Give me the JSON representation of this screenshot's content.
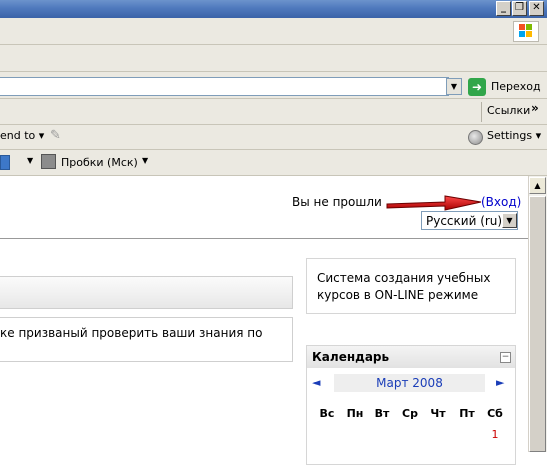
{
  "window": {
    "min_label": "_",
    "max_label": "❐",
    "close_label": "✕"
  },
  "address": {
    "go_label": "Переход"
  },
  "links_bar": {
    "links_label": "Ссылки",
    "chevron": "»"
  },
  "toolbar": {
    "send_to_label": "end to ▾",
    "settings_label": "Settings ▾"
  },
  "traffic_bar": {
    "traffic_label": "Пробки (Мск)"
  },
  "page": {
    "not_logged_in": "Вы не прошли",
    "login_link": "(Вход)",
    "language_value": "Русский (ru)",
    "description_fragment": "ке призваный проверить ваши знания по",
    "system_description": "Система создания учебных курсов в ON-LINE режиме"
  },
  "calendar": {
    "title": "Календарь",
    "month": "Март 2008",
    "prev": "◄",
    "next": "►",
    "weekdays": [
      "Вс",
      "Пн",
      "Вт",
      "Ср",
      "Чт",
      "Пт",
      "Сб"
    ],
    "first_day": "1"
  },
  "colors": {
    "accent_red": "#cc0000",
    "link_blue": "#0000cc",
    "go_green": "#31a64a"
  }
}
